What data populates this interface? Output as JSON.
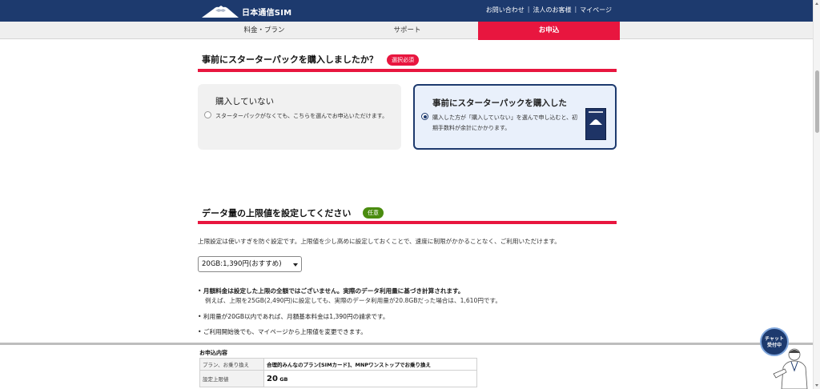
{
  "header": {
    "logo_text": "日本通信SIM",
    "links": [
      "お問い合わせ",
      "法人のお客様",
      "マイページ"
    ],
    "separator": "|"
  },
  "nav": {
    "items": [
      "料金・プラン",
      "サポート",
      "お申込"
    ],
    "active_index": 2
  },
  "starter": {
    "title": "事前にスターターパックを購入しましたか？",
    "badge": "選択必須",
    "option_a": {
      "title": "購入していない",
      "desc": "スターターパックがなくても、こちらを選んでお申込いただけます。",
      "selected": false
    },
    "option_b": {
      "title": "事前にスターターパックを購入した",
      "desc": "購入した方が「購入していない」を選んで申し込むと、初期手数料が余計にかかります。",
      "selected": true
    }
  },
  "data_limit": {
    "title": "データ量の上限値を設定してください",
    "badge": "任意",
    "description": "上限設定は使いすぎを防ぐ設定です。上限値を少し高めに設定しておくことで、速度に制限がかかることなく、ご利用いただけます。",
    "select_value": "20GB:1,390円(おすすめ)",
    "notes": {
      "n1_bold": "月額料金は設定した上限の全額ではございません。実際のデータ利用量に基づき計算されます。",
      "n1_sub": "例えば、上限を25GB(2,490円)に設定しても、実際のデータ利用量が20.8GBだった場合は、1,610円です。",
      "n2": "利用量が20GB以内であれば、月額基本料金は1,390円の請求です。",
      "n3": "ご利用開始後でも、マイページから上限値を変更できます。"
    },
    "bullet": "•"
  },
  "summary": {
    "title": "お申込内容",
    "rows": [
      {
        "key": "プラン、お乗り換え",
        "value": "合理的みんなのプラン[SIMカード]、MNPワンストップでお乗り換え"
      },
      {
        "key": "設定上限値",
        "value_num": "20",
        "value_unit": "GB"
      }
    ]
  },
  "chat": {
    "line1": "チャット",
    "line2": "受付中"
  },
  "colors": {
    "navy": "#1d3a6e",
    "accent_red": "#e8163f",
    "optional_green": "#4a8c0f"
  }
}
